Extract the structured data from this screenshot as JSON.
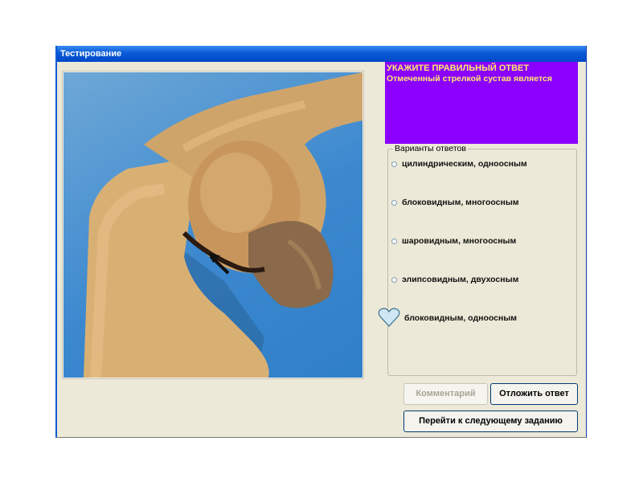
{
  "window": {
    "title": "Тестирование"
  },
  "question": {
    "heading": "УКАЖИТЕ ПРАВИЛЬНЫЙ ОТВЕТ",
    "text": "Отмеченный стрелкой сустав является"
  },
  "answers": {
    "title": "Варианты ответов",
    "options": [
      {
        "label": "цилиндрическим, одноосным"
      },
      {
        "label": "блоковидным, многоосным"
      },
      {
        "label": "шаровидным, многоосным"
      },
      {
        "label": "элипсовидным, двухосным"
      },
      {
        "label": "блоковидным, одноосным"
      }
    ]
  },
  "buttons": {
    "comment": "Комментарий",
    "postpone": "Отложить ответ",
    "next": "Перейти к следующему заданию"
  },
  "colors": {
    "title_bar": "#0a5ad8",
    "question_bg": "#8b00ff",
    "question_text": "#ffeb6a",
    "window_bg": "#ece9d8"
  },
  "icons": {
    "cursor": "heart-icon"
  }
}
